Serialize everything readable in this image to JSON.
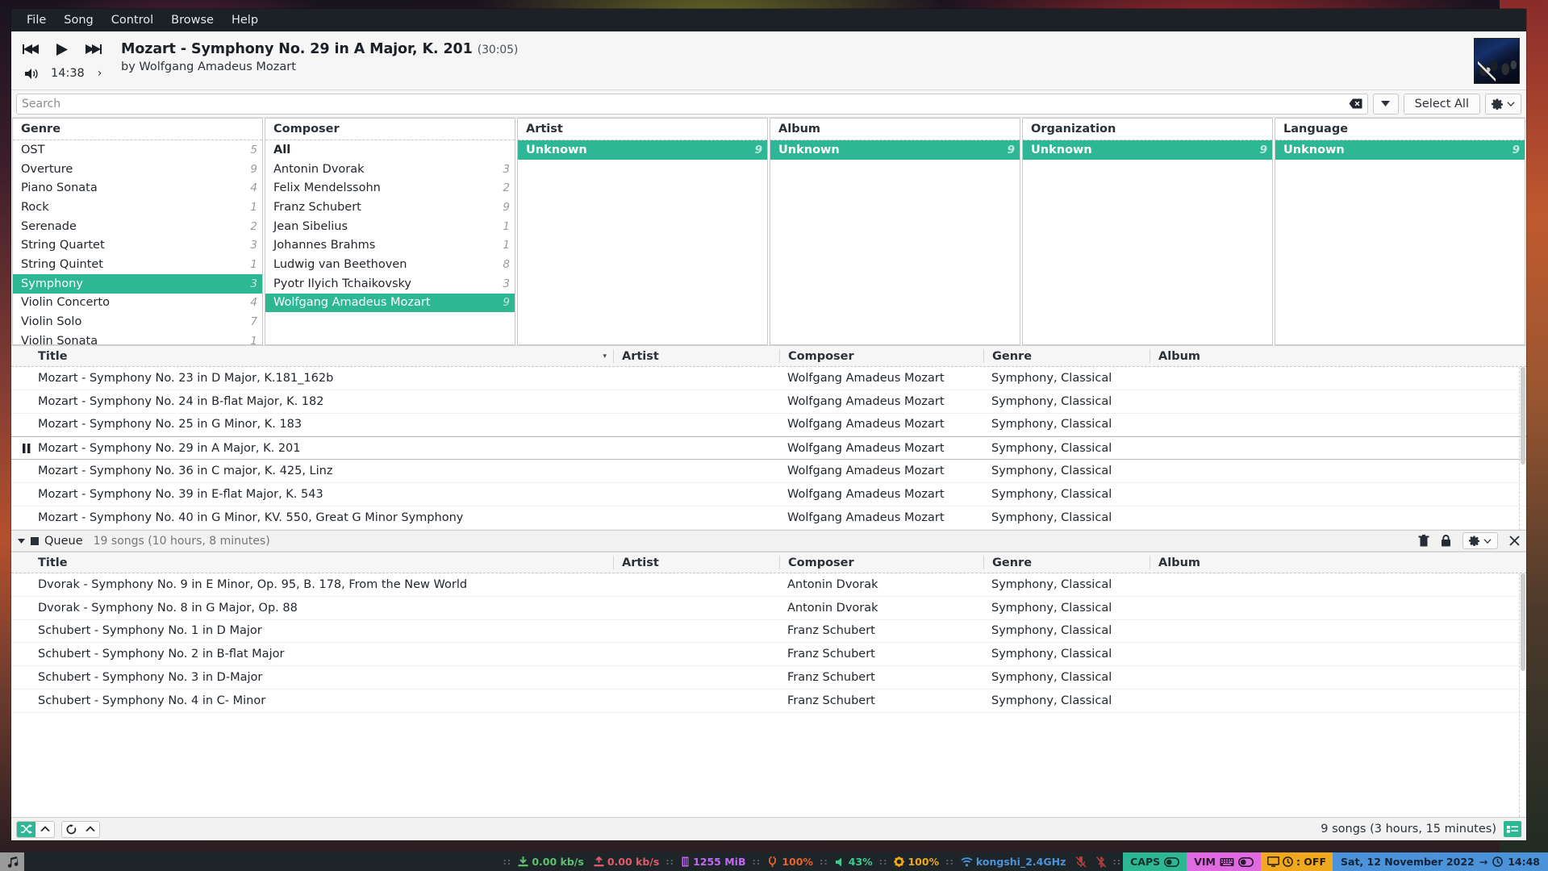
{
  "menubar": {
    "items": [
      "File",
      "Song",
      "Control",
      "Browse",
      "Help"
    ]
  },
  "player": {
    "prev_icon": "skip-previous-icon",
    "play_icon": "play-icon",
    "next_icon": "skip-next-icon",
    "volume_icon": "volume-icon",
    "elapsed": "14:38",
    "chevron": "›",
    "title": "Mozart - Symphony No. 29 in A Major, K. 201",
    "duration": "(30:05)",
    "byline": "by Wolfgang Amadeus Mozart"
  },
  "search": {
    "value": "",
    "placeholder": "Search",
    "clear_icon": "clear-search-icon",
    "dropdown_icon": "chevron-down-icon",
    "select_all_label": "Select All",
    "gear_icon": "gear-icon",
    "gear_chevron": "chevron-down-icon"
  },
  "panes": [
    {
      "title": "Genre",
      "rows": [
        {
          "label": "OST",
          "count": "5",
          "selected": false,
          "bold": false
        },
        {
          "label": "Overture",
          "count": "9",
          "selected": false,
          "bold": false
        },
        {
          "label": "Piano Sonata",
          "count": "4",
          "selected": false,
          "bold": false
        },
        {
          "label": "Rock",
          "count": "1",
          "selected": false,
          "bold": false
        },
        {
          "label": "Serenade",
          "count": "2",
          "selected": false,
          "bold": false
        },
        {
          "label": "String Quartet",
          "count": "3",
          "selected": false,
          "bold": false
        },
        {
          "label": "String Quintet",
          "count": "1",
          "selected": false,
          "bold": false
        },
        {
          "label": "Symphony",
          "count": "3",
          "selected": true,
          "bold": false
        },
        {
          "label": "Violin Concerto",
          "count": "4",
          "selected": false,
          "bold": false
        },
        {
          "label": "Violin Solo",
          "count": "7",
          "selected": false,
          "bold": false
        },
        {
          "label": "Violin Sonata",
          "count": "1",
          "selected": false,
          "bold": false
        }
      ]
    },
    {
      "title": "Composer",
      "rows": [
        {
          "label": "All",
          "count": "",
          "selected": false,
          "bold": true
        },
        {
          "label": "Antonin Dvorak",
          "count": "3",
          "selected": false,
          "bold": false
        },
        {
          "label": "Felix Mendelssohn",
          "count": "2",
          "selected": false,
          "bold": false
        },
        {
          "label": "Franz Schubert",
          "count": "9",
          "selected": false,
          "bold": false
        },
        {
          "label": "Jean Sibelius",
          "count": "1",
          "selected": false,
          "bold": false
        },
        {
          "label": "Johannes Brahms",
          "count": "1",
          "selected": false,
          "bold": false
        },
        {
          "label": "Ludwig van Beethoven",
          "count": "8",
          "selected": false,
          "bold": false
        },
        {
          "label": "Pyotr Ilyich Tchaikovsky",
          "count": "3",
          "selected": false,
          "bold": false
        },
        {
          "label": "Wolfgang Amadeus Mozart",
          "count": "9",
          "selected": true,
          "bold": false
        }
      ]
    },
    {
      "title": "Artist",
      "rows": [
        {
          "label": "Unknown",
          "count": "9",
          "selected": true,
          "bold": true
        }
      ]
    },
    {
      "title": "Album",
      "rows": [
        {
          "label": "Unknown",
          "count": "9",
          "selected": true,
          "bold": true
        }
      ]
    },
    {
      "title": "Organization",
      "rows": [
        {
          "label": "Unknown",
          "count": "9",
          "selected": true,
          "bold": true
        }
      ]
    },
    {
      "title": "Language",
      "rows": [
        {
          "label": "Unknown",
          "count": "9",
          "selected": true,
          "bold": true
        }
      ]
    }
  ],
  "songlist": {
    "columns": [
      "Title",
      "Artist",
      "Composer",
      "Genre",
      "Album"
    ],
    "sort_indicator": "▾",
    "playing_icon": "pause-icon",
    "rows": [
      {
        "title": "Mozart - Symphony No. 23 in D Major, K.181_162b",
        "artist": "",
        "composer": "Wolfgang Amadeus Mozart",
        "genre": "Symphony, Classical",
        "album": "",
        "playing": false
      },
      {
        "title": "Mozart - Symphony No. 24 in B-flat Major, K. 182",
        "artist": "",
        "composer": "Wolfgang Amadeus Mozart",
        "genre": "Symphony, Classical",
        "album": "",
        "playing": false
      },
      {
        "title": "Mozart - Symphony No. 25 in G Minor, K. 183",
        "artist": "",
        "composer": "Wolfgang Amadeus Mozart",
        "genre": "Symphony, Classical",
        "album": "",
        "playing": false
      },
      {
        "title": "Mozart - Symphony No. 29 in A Major, K. 201",
        "artist": "",
        "composer": "Wolfgang Amadeus Mozart",
        "genre": "Symphony, Classical",
        "album": "",
        "playing": true
      },
      {
        "title": "Mozart - Symphony No. 36 in C major, K. 425, Linz",
        "artist": "",
        "composer": "Wolfgang Amadeus Mozart",
        "genre": "Symphony, Classical",
        "album": "",
        "playing": false
      },
      {
        "title": "Mozart - Symphony No. 39 in E-flat Major, K. 543",
        "artist": "",
        "composer": "Wolfgang Amadeus Mozart",
        "genre": "Symphony, Classical",
        "album": "",
        "playing": false
      },
      {
        "title": "Mozart - Symphony No. 40 in G Minor, KV. 550, Great G Minor Symphony",
        "artist": "",
        "composer": "Wolfgang Amadeus Mozart",
        "genre": "Symphony, Classical",
        "album": "",
        "playing": false
      }
    ]
  },
  "queue": {
    "collapse_icon": "triangle-down-icon",
    "stop_icon": "stop-icon",
    "label": "Queue",
    "summary": "19 songs (10 hours, 8 minutes)",
    "tools": [
      {
        "name": "trash-icon"
      },
      {
        "name": "lock-icon"
      },
      {
        "name": "gear-icon"
      },
      {
        "name": "close-icon"
      }
    ],
    "columns": [
      "Title",
      "Artist",
      "Composer",
      "Genre",
      "Album"
    ],
    "rows": [
      {
        "title": "Dvorak - Symphony No. 9 in E Minor, Op. 95, B. 178, From the New World",
        "artist": "",
        "composer": "Antonin Dvorak",
        "genre": "Symphony, Classical",
        "album": ""
      },
      {
        "title": "Dvorak - Symphony No. 8 in G Major, Op. 88",
        "artist": "",
        "composer": "Antonin Dvorak",
        "genre": "Symphony, Classical",
        "album": ""
      },
      {
        "title": "Schubert - Symphony No. 1 in D Major",
        "artist": "",
        "composer": "Franz Schubert",
        "genre": "Symphony, Classical",
        "album": ""
      },
      {
        "title": "Schubert - Symphony No. 2 in B-flat Major",
        "artist": "",
        "composer": "Franz Schubert",
        "genre": "Symphony, Classical",
        "album": ""
      },
      {
        "title": "Schubert - Symphony No. 3 in D-Major",
        "artist": "",
        "composer": "Franz Schubert",
        "genre": "Symphony, Classical",
        "album": ""
      },
      {
        "title": "Schubert - Symphony No. 4 in C- Minor",
        "artist": "",
        "composer": "Franz Schubert",
        "genre": "Symphony, Classical",
        "album": ""
      }
    ]
  },
  "statusbar": {
    "shuffle_icon": "shuffle-icon",
    "shuffle_chevron": "chevron-up-icon",
    "repeat_icon": "repeat-icon",
    "repeat_chevron": "chevron-up-icon",
    "count": "9 songs (3 hours, 15 minutes)",
    "view_icon": "list-view-icon"
  },
  "taskbar": {
    "app_icon": "music-note-icon",
    "download": {
      "icon": "download-icon",
      "value": "0.00 kb/s",
      "color": "#5fbf70"
    },
    "upload": {
      "icon": "upload-icon",
      "value": "0.00 kb/s",
      "color": "#e05a6a"
    },
    "memory": {
      "icon": "memory-icon",
      "value": "1255 MiB",
      "color": "#c06bf0"
    },
    "power": {
      "icon": "power-plug-icon",
      "value": "100%",
      "color": "#e8622a"
    },
    "volume": {
      "icon": "speaker-icon",
      "value": "43%",
      "color": "#3ec98f"
    },
    "brightness": {
      "icon": "brightness-icon",
      "value": "100%",
      "color": "#f0a81e"
    },
    "wifi": {
      "icon": "wifi-icon",
      "value": "kongshi_2.4GHz",
      "color": "#4b92d8"
    },
    "bluetooth_off_icon": "bluetooth-off-icon",
    "mic_off_icon": "mic-off-icon",
    "caps": {
      "label": "CAPS",
      "toggle_icon": "toggle-off-icon"
    },
    "vim": {
      "label": "VIM",
      "keyboard_icon": "keyboard-icon",
      "toggle_icon": "toggle-off-icon"
    },
    "timer": {
      "monitor_icon": "monitor-icon",
      "clock_icon": "clock-icon",
      "label": ": OFF"
    },
    "clock": {
      "date": "Sat, 12 November 2022",
      "arrow": "→",
      "clock_icon": "clock-icon",
      "time": "14:48"
    }
  },
  "colors": {
    "accent": "#2eb795",
    "menubar_bg": "#1b2126",
    "taskbar_bg": "#1e2529"
  }
}
